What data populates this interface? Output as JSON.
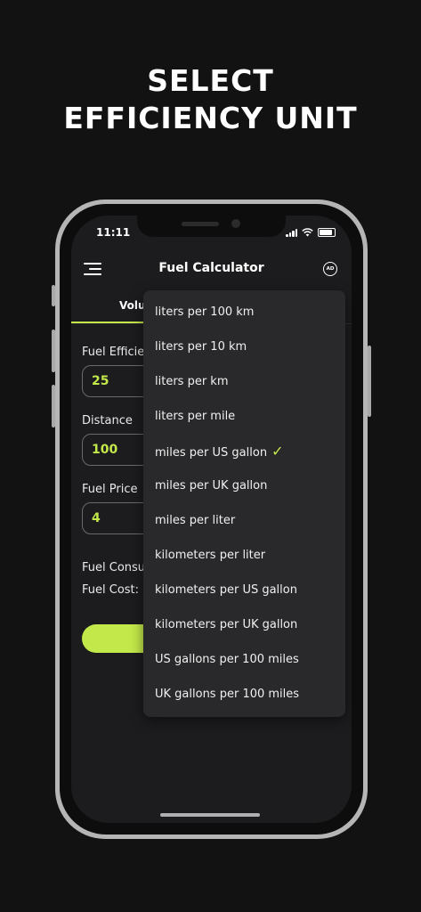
{
  "headline": {
    "line1": "SELECT",
    "line2": "EFFICIENCY UNIT"
  },
  "status_bar": {
    "time": "11:11"
  },
  "app": {
    "title": "Fuel Calculator",
    "ad_badge": "AD"
  },
  "tabs": [
    {
      "label": "Volu",
      "active": true
    }
  ],
  "form": {
    "fuel_efficiency": {
      "label": "Fuel Efficie",
      "value": "25"
    },
    "distance": {
      "label": "Distance",
      "value": "100"
    },
    "fuel_price": {
      "label": "Fuel Price",
      "value": "4"
    }
  },
  "results": {
    "fuel_consumption_label": "Fuel Consu",
    "fuel_cost_label": "Fuel Cost:"
  },
  "dropdown": {
    "options": [
      "liters per 100 km",
      "liters per 10 km",
      "liters per km",
      "liters per mile",
      "miles per US gallon",
      "miles per UK gallon",
      "miles per liter",
      "kilometers per liter",
      "kilometers per US gallon",
      "kilometers per UK gallon",
      "US gallons per 100 miles",
      "UK gallons per 100 miles"
    ],
    "selected_index": 4,
    "check_mark": "✓"
  },
  "colors": {
    "accent": "#c3e84a",
    "background": "#121212",
    "screen": "#1c1c1e",
    "dropdown": "#29292b",
    "frame": "#b5b5b5"
  },
  "icons": [
    "menu-icon",
    "ad-icon",
    "signal-icon",
    "wifi-icon",
    "battery-icon",
    "checkmark-icon"
  ]
}
